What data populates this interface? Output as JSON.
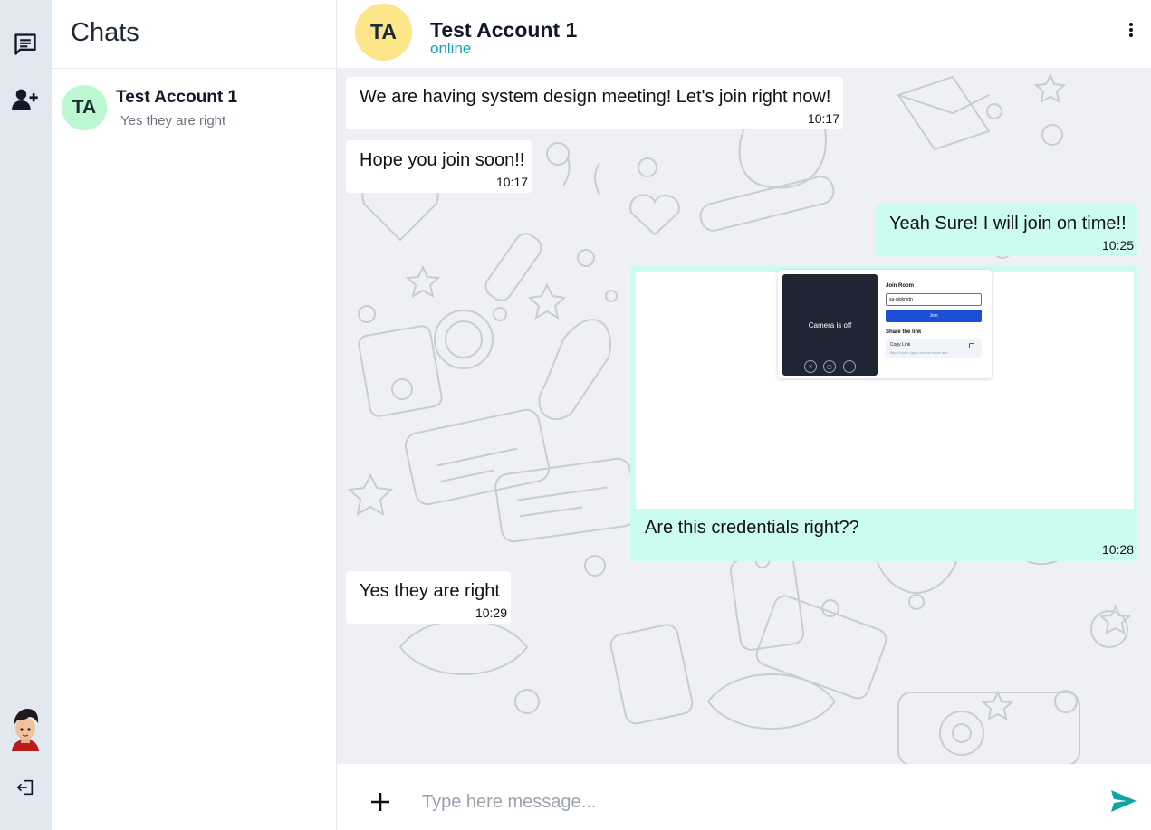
{
  "colors": {
    "accent": "#0ea5a4",
    "online": "#14a3b8",
    "outgoing_bubble": "#ccfbf1",
    "incoming_bubble": "#ffffff",
    "rail_bg": "#e2e8f0",
    "chat_bg": "#eef0f3"
  },
  "sidebar": {
    "icons": [
      "chat-icon",
      "add-user-icon",
      "profile-avatar",
      "logout-icon"
    ]
  },
  "chat_list": {
    "title": "Chats",
    "items": [
      {
        "initials": "TA",
        "name": "Test Account 1",
        "preview": "Yes they are right"
      }
    ]
  },
  "header": {
    "initials": "TA",
    "name": "Test Account 1",
    "status": "online",
    "menu_icon": "more-vertical-icon"
  },
  "messages": [
    {
      "dir": "in",
      "text": "We are having system design meeting! Let's join right now!",
      "time": "10:17"
    },
    {
      "dir": "in",
      "text": "Hope you join soon!!",
      "time": "10:17"
    },
    {
      "dir": "out",
      "text": "Yeah Sure! I will join on time!!",
      "time": "10:25"
    },
    {
      "dir": "out",
      "text": "Are this credentials right??",
      "time": "10:28",
      "attachment": {
        "camera_text": "Camera is off",
        "join_title": "Join Room",
        "input_value": "sa-ujgkmdn",
        "join_button": "Join",
        "share_title": "Share the link",
        "copy_label": "Copy Link",
        "link_text": "https://video-app.com/join/room-abc"
      }
    },
    {
      "dir": "in",
      "text": "Yes they are right",
      "time": "10:29"
    }
  ],
  "composer": {
    "placeholder": "Type here message...",
    "attach_icon": "plus-icon",
    "send_icon": "send-icon"
  }
}
